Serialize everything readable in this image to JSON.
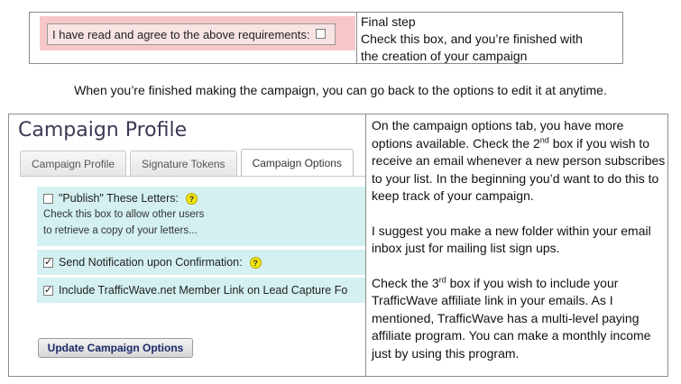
{
  "top_table": {
    "agree_label": "I have read and agree to the above requirements:",
    "agree_checked": false,
    "right_lines": [
      "Final step",
      "Check this box, and you’re finished with",
      "the creation of your campaign"
    ]
  },
  "middle_text": "When you’re finished making the campaign, you can go back to the options to edit it at anytime.",
  "campaign_profile": {
    "title": "Campaign Profile",
    "tabs": [
      {
        "label": "Campaign Profile",
        "active": false
      },
      {
        "label": "Signature Tokens",
        "active": false
      },
      {
        "label": "Campaign Options",
        "active": true
      }
    ],
    "options": [
      {
        "label": "\"Publish\" These Letters:",
        "checked": false,
        "help": "?",
        "sub": [
          "Check this box to allow other users",
          "to retrieve a copy of your letters..."
        ]
      },
      {
        "label": "Send Notification upon Confirmation:",
        "checked": true,
        "help": "?"
      },
      {
        "label": "Include TrafficWave.net Member Link on Lead Capture Fo",
        "checked": true
      }
    ],
    "update_button": "Update Campaign Options"
  },
  "right_text": {
    "p1_a": "On the campaign options tab, you have more options available. Check the 2",
    "p1_sup": "nd",
    "p1_b": " box if you wish to receive an email whenever a new person subscribes to your list. In the beginning you’d want to do this to keep track of your campaign.",
    "p2": "I suggest you make a new folder within your email inbox just for mailing list sign ups.",
    "p3_a": "Check the 3",
    "p3_sup": "rd",
    "p3_b": " box if you wish to include your TrafficWave affiliate link in your emails. As I mentioned, TrafficWave has a multi-level paying affiliate program. You can make a monthly income just by using this program."
  }
}
